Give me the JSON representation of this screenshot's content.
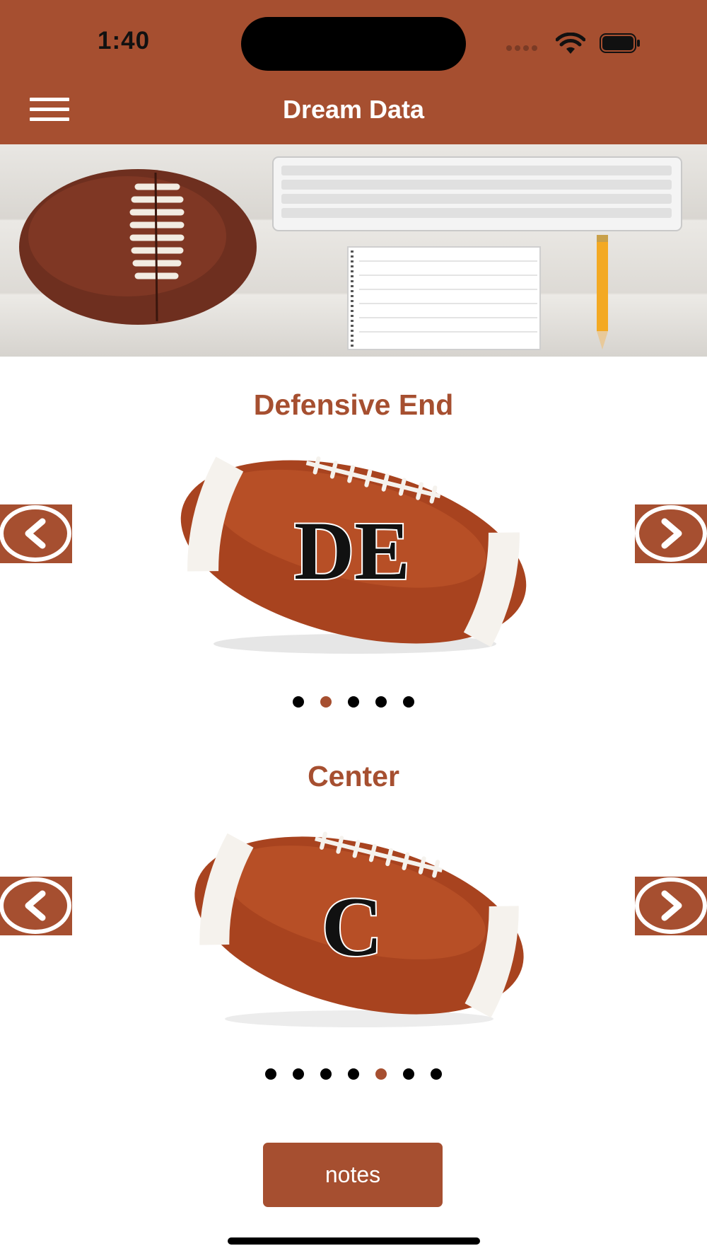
{
  "status_bar": {
    "time": "1:40"
  },
  "header": {
    "title": "Dream Data",
    "menu_icon": "hamburger-menu-icon",
    "color": "#a64f30"
  },
  "banner": {
    "image": "football-keyboard-notepad-pencil"
  },
  "carousels": [
    {
      "title": "Defensive End",
      "ball_label": "DE",
      "prev_icon": "chevron-left-icon",
      "next_icon": "chevron-right-icon",
      "dots_total": 5,
      "active_dot": 2
    },
    {
      "title": "Center",
      "ball_label": "C",
      "prev_icon": "chevron-left-icon",
      "next_icon": "chevron-right-icon",
      "dots_total": 7,
      "active_dot": 5
    }
  ],
  "notes_button": {
    "label": "notes"
  },
  "colors": {
    "accent": "#a64f30",
    "text_on_accent": "#ffffff"
  }
}
